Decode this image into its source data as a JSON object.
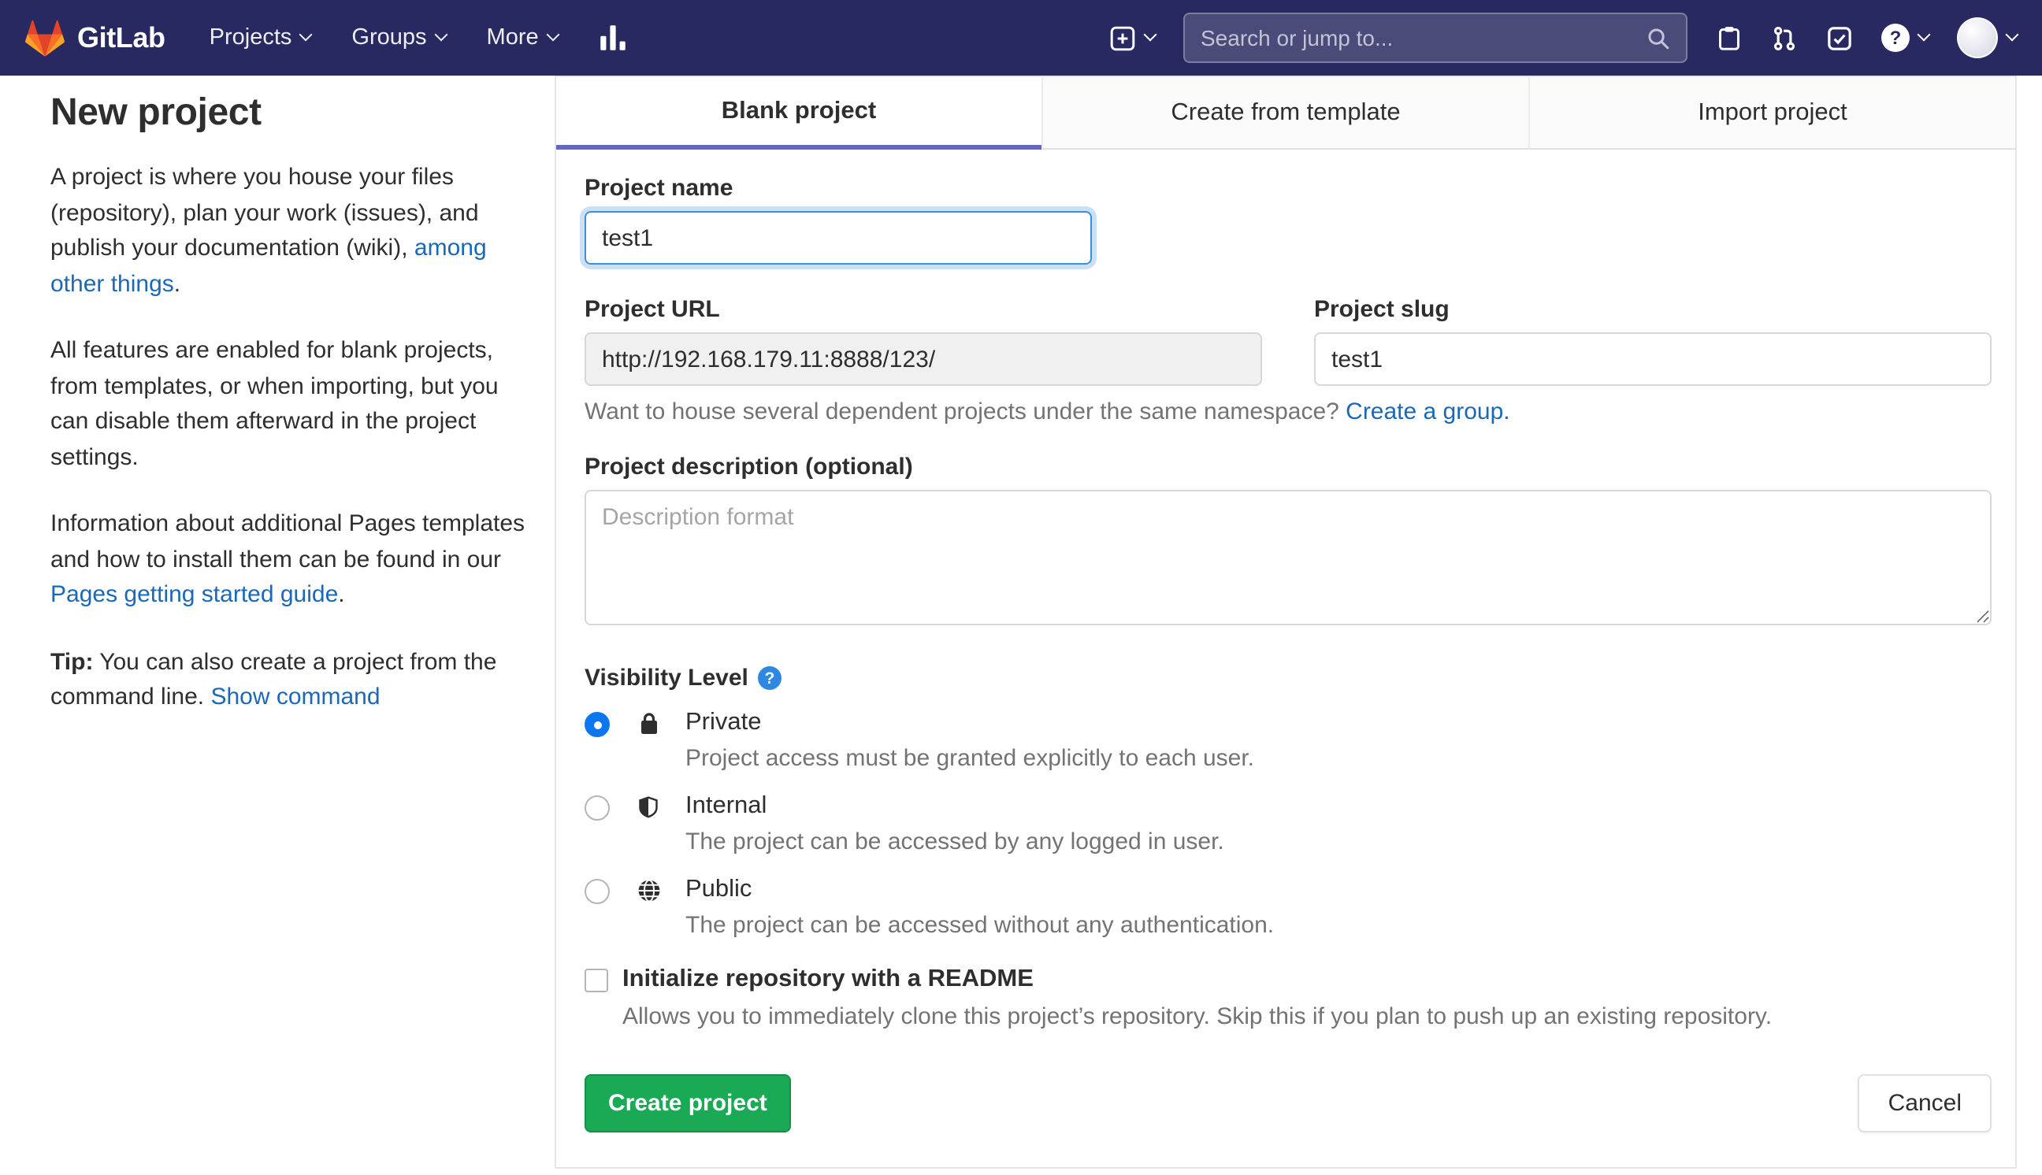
{
  "colors": {
    "navbar": "#292961",
    "link": "#1b69b6",
    "primary_button": "#1aaa55",
    "active_tab_underline": "#6666c4",
    "radio_selected": "#0b76f0"
  },
  "icons": {
    "help_glyph": "?"
  },
  "navbar": {
    "brand": "GitLab",
    "menu": [
      {
        "label": "Projects"
      },
      {
        "label": "Groups"
      },
      {
        "label": "More"
      }
    ],
    "search_placeholder": "Search or jump to..."
  },
  "sidebar": {
    "title": "New project",
    "p1_pre": "A project is where you house your files (repository), plan your work (issues), and publish your documentation (wiki), ",
    "p1_link": "among other things",
    "p1_post": ".",
    "p2": "All features are enabled for blank projects, from templates, or when importing, but you can disable them afterward in the project settings.",
    "p3_pre": "Information about additional Pages templates and how to install them can be found in our ",
    "p3_link": "Pages getting started guide",
    "p3_post": ".",
    "tip_label": "Tip:",
    "tip_text": " You can also create a project from the command line. ",
    "tip_link": "Show command"
  },
  "tabs": [
    {
      "label": "Blank project",
      "active": true
    },
    {
      "label": "Create from template",
      "active": false
    },
    {
      "label": "Import project",
      "active": false
    }
  ],
  "form": {
    "project_name_label": "Project name",
    "project_name_value": "test1",
    "project_url_label": "Project URL",
    "project_url_value": "http://192.168.179.11:8888/123/",
    "project_slug_label": "Project slug",
    "project_slug_value": "test1",
    "namespace_hint": "Want to house several dependent projects under the same namespace? ",
    "namespace_link": "Create a group.",
    "description_label": "Project description (optional)",
    "description_placeholder": "Description format",
    "visibility_label": "Visibility Level",
    "visibility_options": [
      {
        "name": "Private",
        "description": "Project access must be granted explicitly to each user.",
        "selected": true,
        "icon": "lock-icon"
      },
      {
        "name": "Internal",
        "description": "The project can be accessed by any logged in user.",
        "selected": false,
        "icon": "shield-icon"
      },
      {
        "name": "Public",
        "description": "The project can be accessed without any authentication.",
        "selected": false,
        "icon": "globe-icon"
      }
    ],
    "readme_label": "Initialize repository with a README",
    "readme_description": "Allows you to immediately clone this project’s repository. Skip this if you plan to push up an existing repository.",
    "submit_label": "Create project",
    "cancel_label": "Cancel"
  }
}
